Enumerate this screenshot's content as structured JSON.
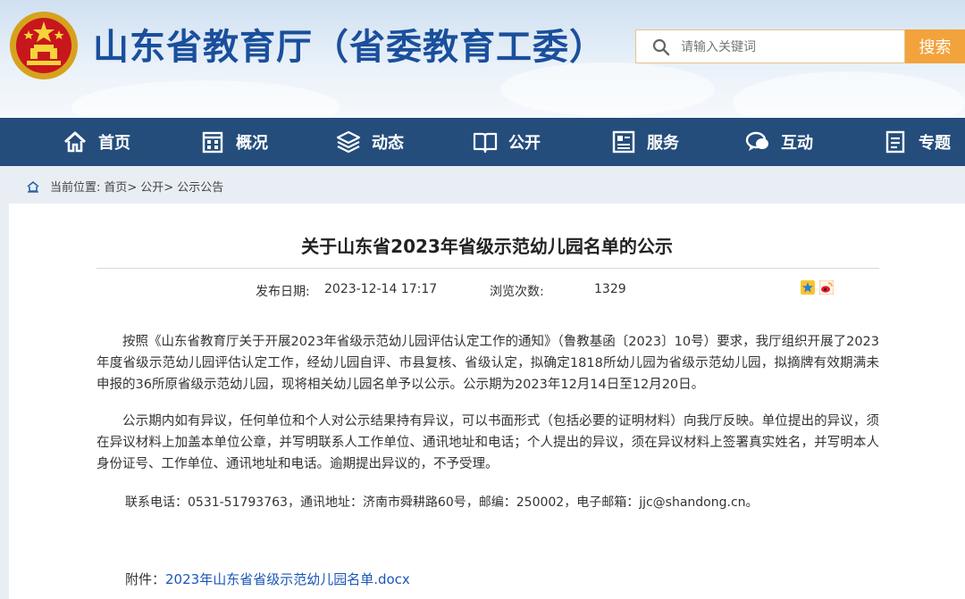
{
  "header": {
    "site_title": "山东省教育厅（省委教育工委）",
    "search_placeholder": "请输入关键词",
    "search_button": "搜索"
  },
  "nav": {
    "items": [
      {
        "label": "首页",
        "icon": "home-icon"
      },
      {
        "label": "概况",
        "icon": "building-icon"
      },
      {
        "label": "动态",
        "icon": "stack-icon"
      },
      {
        "label": "公开",
        "icon": "book-icon"
      },
      {
        "label": "服务",
        "icon": "service-icon"
      },
      {
        "label": "互动",
        "icon": "chat-icon"
      },
      {
        "label": "专题",
        "icon": "document-icon"
      }
    ]
  },
  "breadcrumb": {
    "prefix": "当前位置:",
    "items": [
      "首页>",
      "公开>",
      "公示公告"
    ]
  },
  "article": {
    "title": "关于山东省2023年省级示范幼儿园名单的公示",
    "publish_label": "发布日期:",
    "publish_date": "2023-12-14 17:17",
    "views_label": "浏览次数:",
    "views": "1329",
    "paragraphs": [
      "按照《山东省教育厅关于开展2023年省级示范幼儿园评估认定工作的通知》（鲁教基函〔2023〕10号）要求，我厅组织开展了2023年度省级示范幼儿园评估认定工作，经幼儿园自评、市县复核、省级认定，拟确定1818所幼儿园为省级示范幼儿园，拟摘牌有效期满未申报的36所原省级示范幼儿园，现将相关幼儿园名单予以公示。公示期为2023年12月14日至12月20日。",
      "公示期内如有异议，任何单位和个人对公示结果持有异议，可以书面形式（包括必要的证明材料）向我厅反映。单位提出的异议，须在异议材料上加盖本单位公章，并写明联系人工作单位、通讯地址和电话；个人提出的异议，须在异议材料上签署真实姓名，并写明本人身份证号、工作单位、通讯地址和电话。逾期提出异议的，不予受理。"
    ],
    "contact": "联系电话：0531-51793763，通讯地址：济南市舜耕路60号，邮编：250002，电子邮箱：jjc@shandong.cn。",
    "attachment_label": "附件：",
    "attachment_link": "2023年山东省省级示范幼儿园名单.docx"
  },
  "colors": {
    "nav_bg": "#244d7c",
    "title_blue": "#1a4f9c",
    "search_btn": "#f3a33b",
    "link": "#1a56b8"
  }
}
